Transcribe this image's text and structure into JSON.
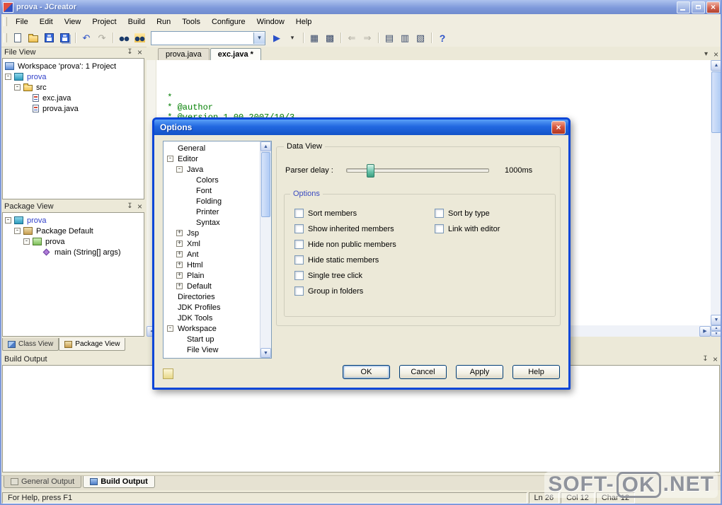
{
  "window": {
    "title": "prova - JCreator"
  },
  "menu": {
    "items": [
      {
        "label": "File",
        "name": "menu-item-file"
      },
      {
        "label": "Edit",
        "name": "menu-item-edit"
      },
      {
        "label": "View",
        "name": "menu-item-view"
      },
      {
        "label": "Project",
        "name": "menu-item-project"
      },
      {
        "label": "Build",
        "name": "menu-item-build"
      },
      {
        "label": "Run",
        "name": "menu-item-run"
      },
      {
        "label": "Tools",
        "name": "menu-item-tools"
      },
      {
        "label": "Configure",
        "name": "menu-item-configure"
      },
      {
        "label": "Window",
        "name": "menu-item-window"
      },
      {
        "label": "Help",
        "name": "menu-item-help"
      }
    ]
  },
  "toolbar": {
    "combo_value": "",
    "icons_left": [
      {
        "name": "new-file-icon"
      },
      {
        "name": "open-folder-icon"
      },
      {
        "name": "save-icon"
      },
      {
        "name": "save-all-icon"
      },
      {
        "name": "toolbar-separator",
        "cls": "tb-sep",
        "interactable": false
      },
      {
        "name": "undo-icon",
        "glyph": "↶",
        "cls": "g-blue"
      },
      {
        "name": "redo-icon",
        "glyph": "↷",
        "cls": "g-gray"
      },
      {
        "name": "toolbar-separator",
        "cls": "tb-sep",
        "interactable": false
      },
      {
        "name": "find-icon"
      },
      {
        "name": "find-in-files-icon"
      }
    ],
    "icons_right": [
      {
        "name": "run-icon",
        "glyph": "▶",
        "cls": "g-blue"
      },
      {
        "name": "run-dropdown-icon",
        "glyph": "▾",
        "cls": "g-dark"
      },
      {
        "name": "toolbar-separator",
        "cls": "tb-sep",
        "interactable": false
      },
      {
        "name": "class-wizard-icon",
        "glyph": "▦"
      },
      {
        "name": "project-pane-icon",
        "glyph": "▩"
      },
      {
        "name": "toolbar-separator",
        "cls": "tb-sep",
        "interactable": false
      },
      {
        "name": "back-icon",
        "glyph": "⇐",
        "cls": "g-gray"
      },
      {
        "name": "forward-icon",
        "glyph": "⇒",
        "cls": "g-gray"
      },
      {
        "name": "toolbar-separator",
        "cls": "tb-sep",
        "interactable": false
      },
      {
        "name": "output-pane-icon",
        "glyph": "▤"
      },
      {
        "name": "view-pane-icon",
        "glyph": "▥"
      },
      {
        "name": "workspace-pane-icon",
        "glyph": "▧"
      },
      {
        "name": "toolbar-separator",
        "cls": "tb-sep",
        "interactable": false
      },
      {
        "name": "help-icon",
        "glyph": "?",
        "cls": "g-blue g-bold"
      }
    ]
  },
  "file_view": {
    "title": "File View",
    "tree": [
      {
        "label": "Workspace 'prova': 1 Project",
        "level": 0,
        "expander": "",
        "icon": "workspace-icon",
        "cls": "noslot"
      },
      {
        "label": "prova",
        "level": 0,
        "expander": "-",
        "icon": "project-icon",
        "cls": "blue"
      },
      {
        "label": "src",
        "level": 1,
        "expander": "-",
        "icon": "folder-icon"
      },
      {
        "label": "exc.java",
        "level": 2,
        "expander": "",
        "icon": "java-file-icon"
      },
      {
        "label": "prova.java",
        "level": 2,
        "expander": "",
        "icon": "java-file-icon"
      }
    ]
  },
  "package_view": {
    "title": "Package View",
    "tree": [
      {
        "label": "prova",
        "level": 0,
        "expander": "-",
        "icon": "project-icon",
        "cls": "blue"
      },
      {
        "label": "Package Default",
        "level": 1,
        "expander": "-",
        "icon": "package-icon"
      },
      {
        "label": "prova",
        "level": 2,
        "expander": "-",
        "icon": "class-icon"
      },
      {
        "label": "main (String[] args)",
        "level": 3,
        "expander": "",
        "icon": "method-icon"
      }
    ]
  },
  "left_tabs": [
    {
      "label": "Class View",
      "name": "tab-class-view",
      "icon": "class-view-icon"
    },
    {
      "label": "Package View",
      "name": "tab-package-view",
      "icon": "package-view-icon",
      "cls": "active"
    }
  ],
  "editor": {
    "tabs": [
      {
        "label": "prova.java",
        "name": "tab-prova-java"
      },
      {
        "label": "exc.java *",
        "name": "tab-exc-java",
        "cls": "active"
      }
    ],
    "code_lines": [
      " *",
      " * @author",
      " * @version 1.00 2007/10/3",
      " */"
    ]
  },
  "build_output": {
    "title": "Build Output"
  },
  "bottom_tabs": [
    {
      "label": "General Output",
      "name": "tab-general-output",
      "icon": "general-output-icon"
    },
    {
      "label": "Build Output",
      "name": "tab-build-output",
      "icon": "build-output-icon",
      "cls": "active"
    }
  ],
  "status": {
    "help": "For Help, press F1",
    "fields": [
      "Ln 26",
      "Col 12",
      "Char 12"
    ]
  },
  "dialog": {
    "title": "Options",
    "tree": [
      {
        "label": "General",
        "level": 0,
        "expander": ""
      },
      {
        "label": "Editor",
        "level": 0,
        "expander": "-"
      },
      {
        "label": "Java",
        "level": 1,
        "expander": "-"
      },
      {
        "label": "Colors",
        "level": 2,
        "expander": ""
      },
      {
        "label": "Font",
        "level": 2,
        "expander": ""
      },
      {
        "label": "Folding",
        "level": 2,
        "expander": ""
      },
      {
        "label": "Printer",
        "level": 2,
        "expander": ""
      },
      {
        "label": "Syntax",
        "level": 2,
        "expander": ""
      },
      {
        "label": "Jsp",
        "level": 1,
        "expander": "+"
      },
      {
        "label": "Xml",
        "level": 1,
        "expander": "+"
      },
      {
        "label": "Ant",
        "level": 1,
        "expander": "+"
      },
      {
        "label": "Html",
        "level": 1,
        "expander": "+"
      },
      {
        "label": "Plain",
        "level": 1,
        "expander": "+"
      },
      {
        "label": "Default",
        "level": 1,
        "expander": "+"
      },
      {
        "label": "Directories",
        "level": 0,
        "expander": ""
      },
      {
        "label": "JDK Profiles",
        "level": 0,
        "expander": ""
      },
      {
        "label": "JDK Tools",
        "level": 0,
        "expander": ""
      },
      {
        "label": "Workspace",
        "level": 0,
        "expander": "-"
      },
      {
        "label": "Start up",
        "level": 1,
        "expander": ""
      },
      {
        "label": "File View",
        "level": 1,
        "expander": ""
      }
    ],
    "data_view": {
      "legend": "Data View",
      "parser_label": "Parser delay :",
      "parser_value": "1000ms",
      "options_legend": "Options",
      "checkboxes_left": [
        "Sort members",
        "Show inherited members",
        "Hide non public members",
        "Hide static members",
        "Single tree click",
        "Group in folders"
      ],
      "checkboxes_right": [
        "Sort by type",
        "Link with editor"
      ]
    },
    "buttons": [
      {
        "label": "OK",
        "name": "ok-button",
        "cls": "default-button"
      },
      {
        "label": "Cancel",
        "name": "cancel-button"
      },
      {
        "label": "Apply",
        "name": "apply-button"
      },
      {
        "label": "Help",
        "name": "help-button"
      }
    ]
  },
  "watermark": {
    "prefix": "SOFT-",
    "boxed": "OK",
    "suffix": ".NET"
  },
  "colors": {
    "dialog_title_blue": "#1353C8",
    "comment_green": "#007F00",
    "project_name_blue": "#2E3EC8"
  }
}
